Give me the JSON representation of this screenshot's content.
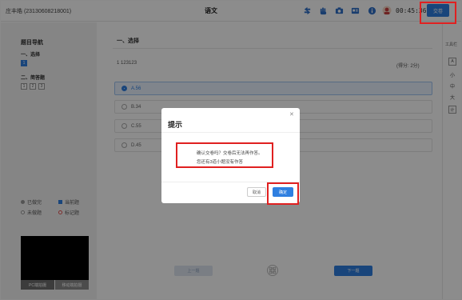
{
  "header": {
    "student": "庄丰皓 (23130608218001)",
    "subject": "语文",
    "icons": [
      "refresh-icon",
      "hand-icon",
      "camera-icon",
      "id-card-icon",
      "info-icon",
      "avatar-icon"
    ],
    "timer": "00:45:36",
    "submit_label": "交卷"
  },
  "sidebar": {
    "title": "题目导航",
    "sections": [
      {
        "title": "一、选择",
        "questions": [
          "1"
        ]
      },
      {
        "title": "二、简答题",
        "questions": [
          "1",
          "2",
          "3"
        ]
      }
    ],
    "legend": [
      {
        "label": "已做完",
        "color": "#9a9a9a"
      },
      {
        "label": "当前题",
        "color": "#2f7fe0"
      },
      {
        "label": "未做题",
        "color": "#ffffff"
      },
      {
        "label": "标记题",
        "color": "#e05050"
      }
    ],
    "camera_buttons": [
      "PC端拍摄",
      "移动端拍摄"
    ]
  },
  "main": {
    "section_title": "一、选择",
    "question_number": "1",
    "question_text": "123123",
    "score": "(得分: 2分)",
    "options": [
      {
        "label": "A.56",
        "selected": true
      },
      {
        "label": "B.34",
        "selected": false
      },
      {
        "label": "C.55",
        "selected": false
      },
      {
        "label": "D.45",
        "selected": false
      }
    ],
    "prev_label": "上一题",
    "next_label": "下一题",
    "grid_icon": "grid-icon"
  },
  "toolbar": {
    "title": "工具栏",
    "items": [
      "A",
      "小",
      "中",
      "大",
      "计"
    ]
  },
  "dialog": {
    "title": "提示",
    "line1": "确认交卷吗？交卷后无法再作答。",
    "line2": "您还有3道小题没有作答",
    "cancel_label": "取消",
    "confirm_label": "确定"
  }
}
